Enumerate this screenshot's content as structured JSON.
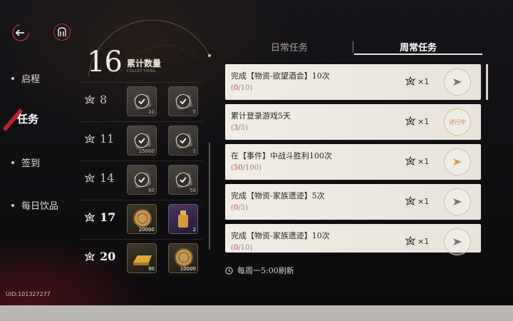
{
  "sidebar": {
    "items": [
      {
        "label": "启程",
        "active": false
      },
      {
        "label": "任务",
        "active": true
      },
      {
        "label": "签到",
        "active": false
      },
      {
        "label": "每日饮品",
        "active": false
      }
    ],
    "uid": "UID:101327277"
  },
  "collection": {
    "count": "16",
    "label": "累计数量",
    "sub_label": "COLLECTIONS",
    "milestones": [
      {
        "threshold": "8",
        "claimable": false,
        "items": [
          {
            "qty": "10",
            "claimed": true
          },
          {
            "qty": "5",
            "claimed": true
          }
        ]
      },
      {
        "threshold": "11",
        "claimable": false,
        "items": [
          {
            "qty": "15000",
            "claimed": true
          },
          {
            "qty": "1",
            "claimed": true
          }
        ]
      },
      {
        "threshold": "14",
        "claimable": false,
        "items": [
          {
            "qty": "60",
            "claimed": true
          },
          {
            "qty": "50",
            "claimed": true
          }
        ]
      },
      {
        "threshold": "17",
        "claimable": true,
        "items": [
          {
            "qty": "20000",
            "claimed": false
          },
          {
            "qty": "2",
            "claimed": false
          }
        ]
      },
      {
        "threshold": "20",
        "claimable": true,
        "items": [
          {
            "qty": "90",
            "claimed": false
          },
          {
            "qty": "10000",
            "claimed": false
          }
        ]
      }
    ]
  },
  "tabs": [
    {
      "label": "日常任务",
      "active": false
    },
    {
      "label": "周常任务",
      "active": true
    }
  ],
  "tasks": [
    {
      "title": "完成【物资-欲望酒会】10次",
      "cur": "0",
      "total": "/10",
      "reward": "×1",
      "button": "go"
    },
    {
      "title": "累计登录游戏5天",
      "cur": "3",
      "total": "/5",
      "reward": "×1",
      "button": "进行中"
    },
    {
      "title": "在【事件】中战斗胜利100次",
      "cur": "50",
      "total": "/100",
      "reward": "×1",
      "button": "go-highlight"
    },
    {
      "title": "完成【物资-家族遗迹】5次",
      "cur": "0",
      "total": "/5",
      "reward": "×1",
      "button": "go"
    },
    {
      "title": "完成【物资-家族遗迹】10次",
      "cur": "0",
      "total": "/10",
      "reward": "×1",
      "button": "go"
    }
  ],
  "refresh_text": "每周一5:00刷新",
  "colors": {
    "accent_red": "#c0443c",
    "gold": "#d6a24a",
    "card_bg": "#eeeae3"
  }
}
